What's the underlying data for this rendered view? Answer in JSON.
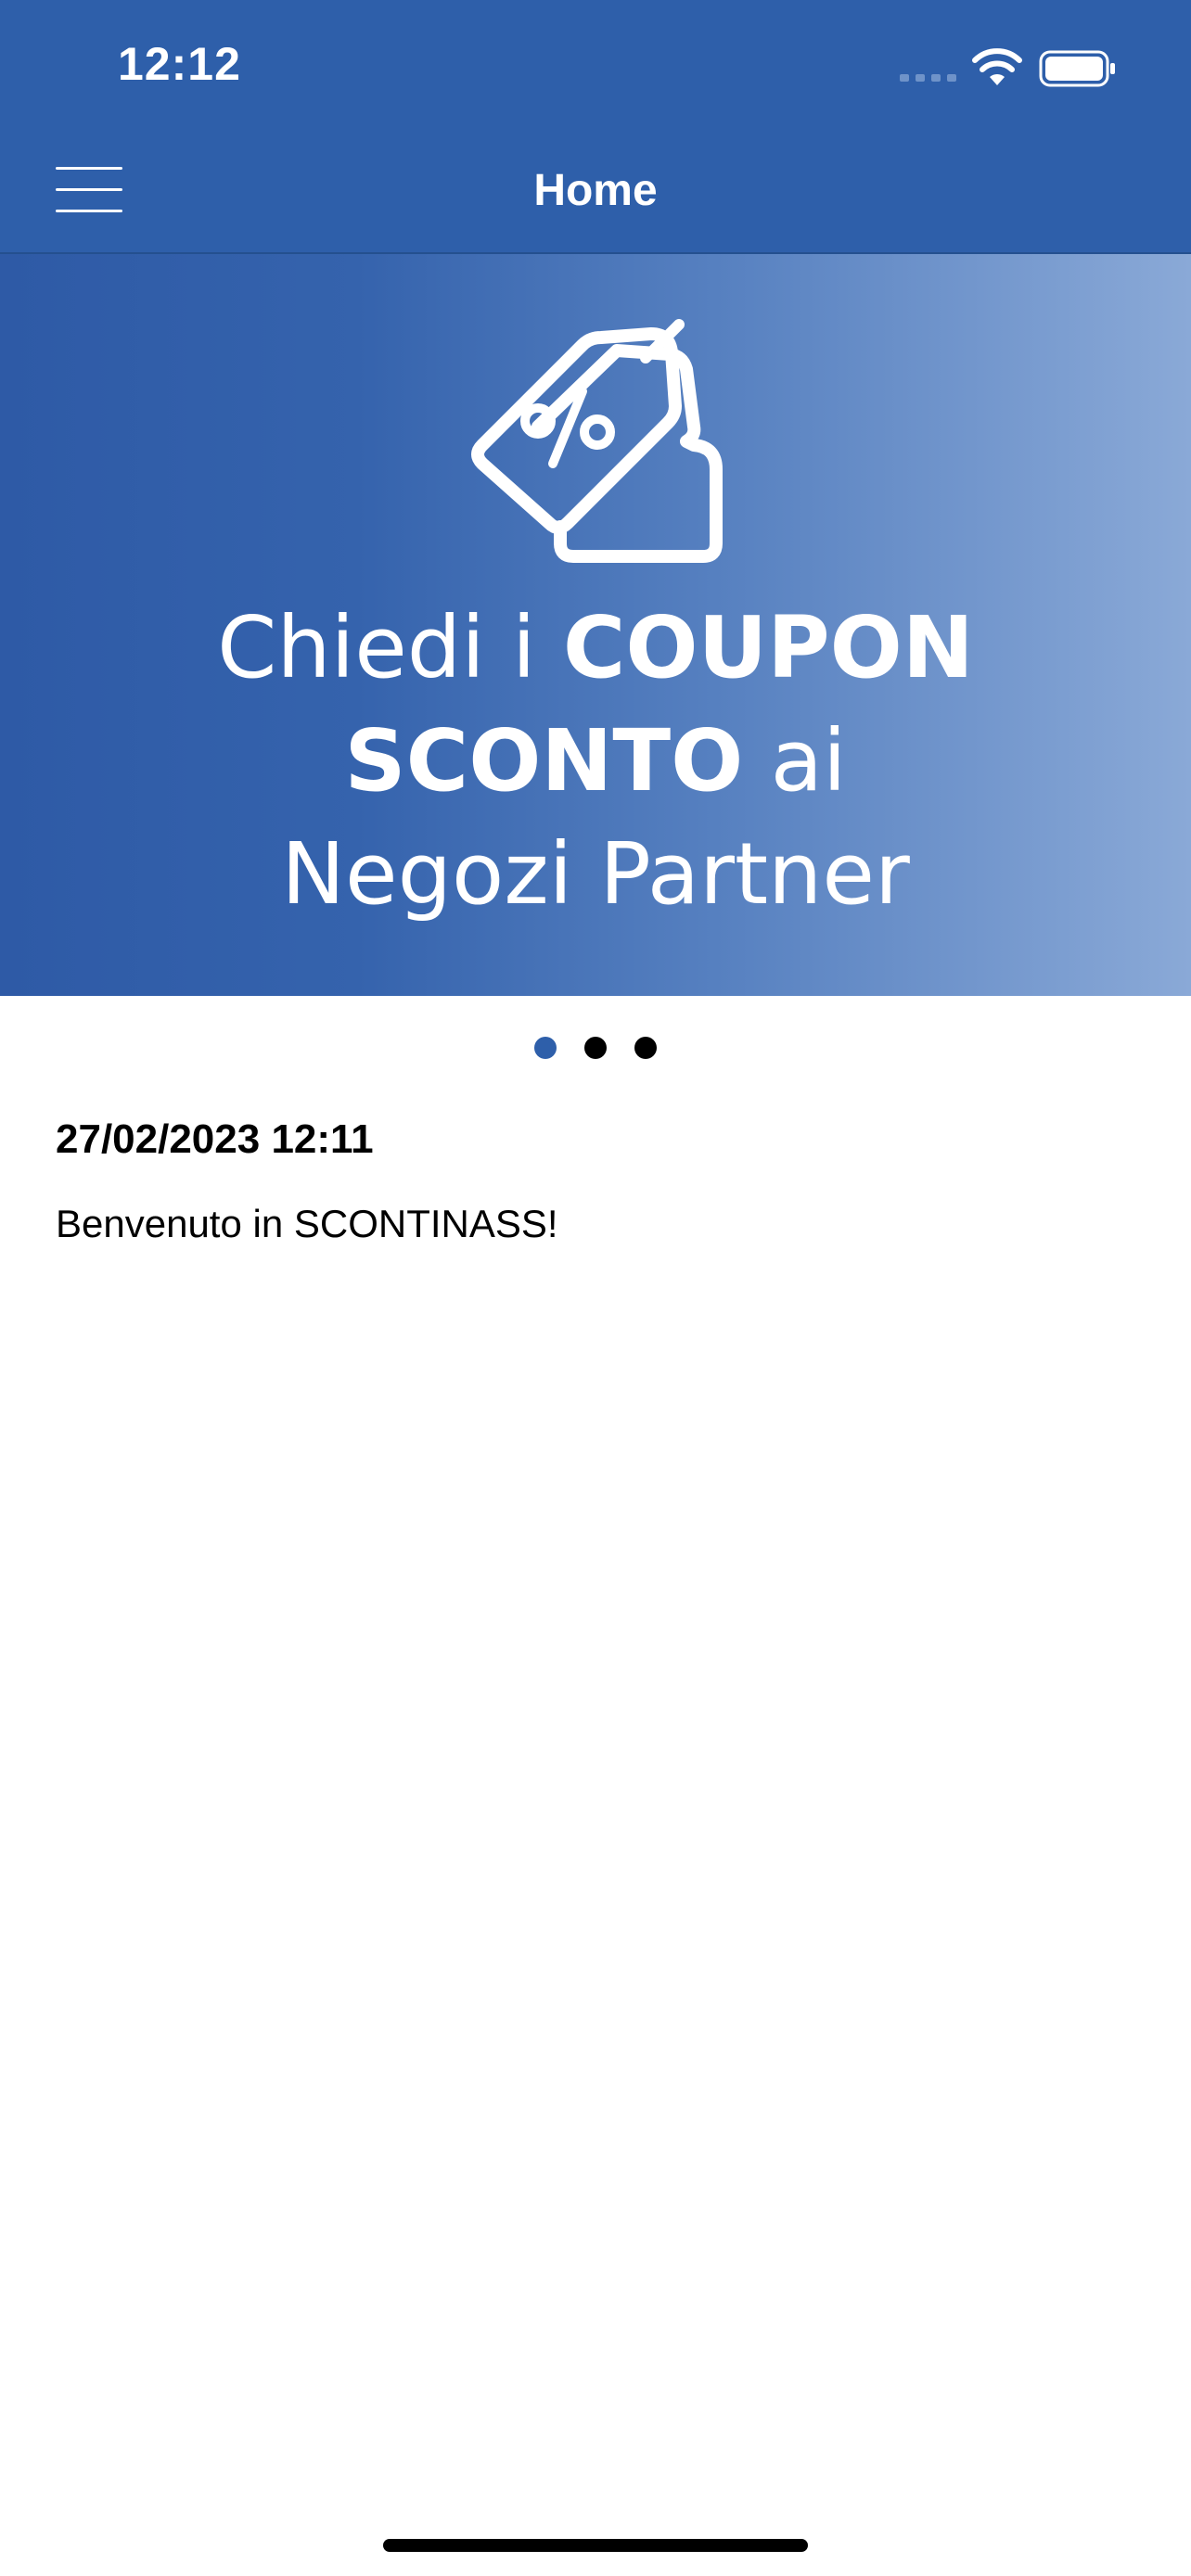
{
  "status_bar": {
    "time": "12:12"
  },
  "nav": {
    "title": "Home",
    "menu_icon": "hamburger-menu-icon"
  },
  "banner": {
    "icon": "coupon-tag-percent-icon",
    "line1_normal": "Chiedi i ",
    "line1_bold": "COUPON",
    "line2_bold": "SCONTO",
    "line2_normal": " ai",
    "line3": "Negozi Partner"
  },
  "carousel": {
    "pages": 3,
    "active_index": 0
  },
  "message": {
    "date": "27/02/2023 12:11",
    "text": "Benvenuto in SCONTINASS!"
  },
  "colors": {
    "primary": "#2e5faa",
    "banner_gradient_end": "#8aa9d7",
    "text": "#000000",
    "background": "#ffffff"
  }
}
